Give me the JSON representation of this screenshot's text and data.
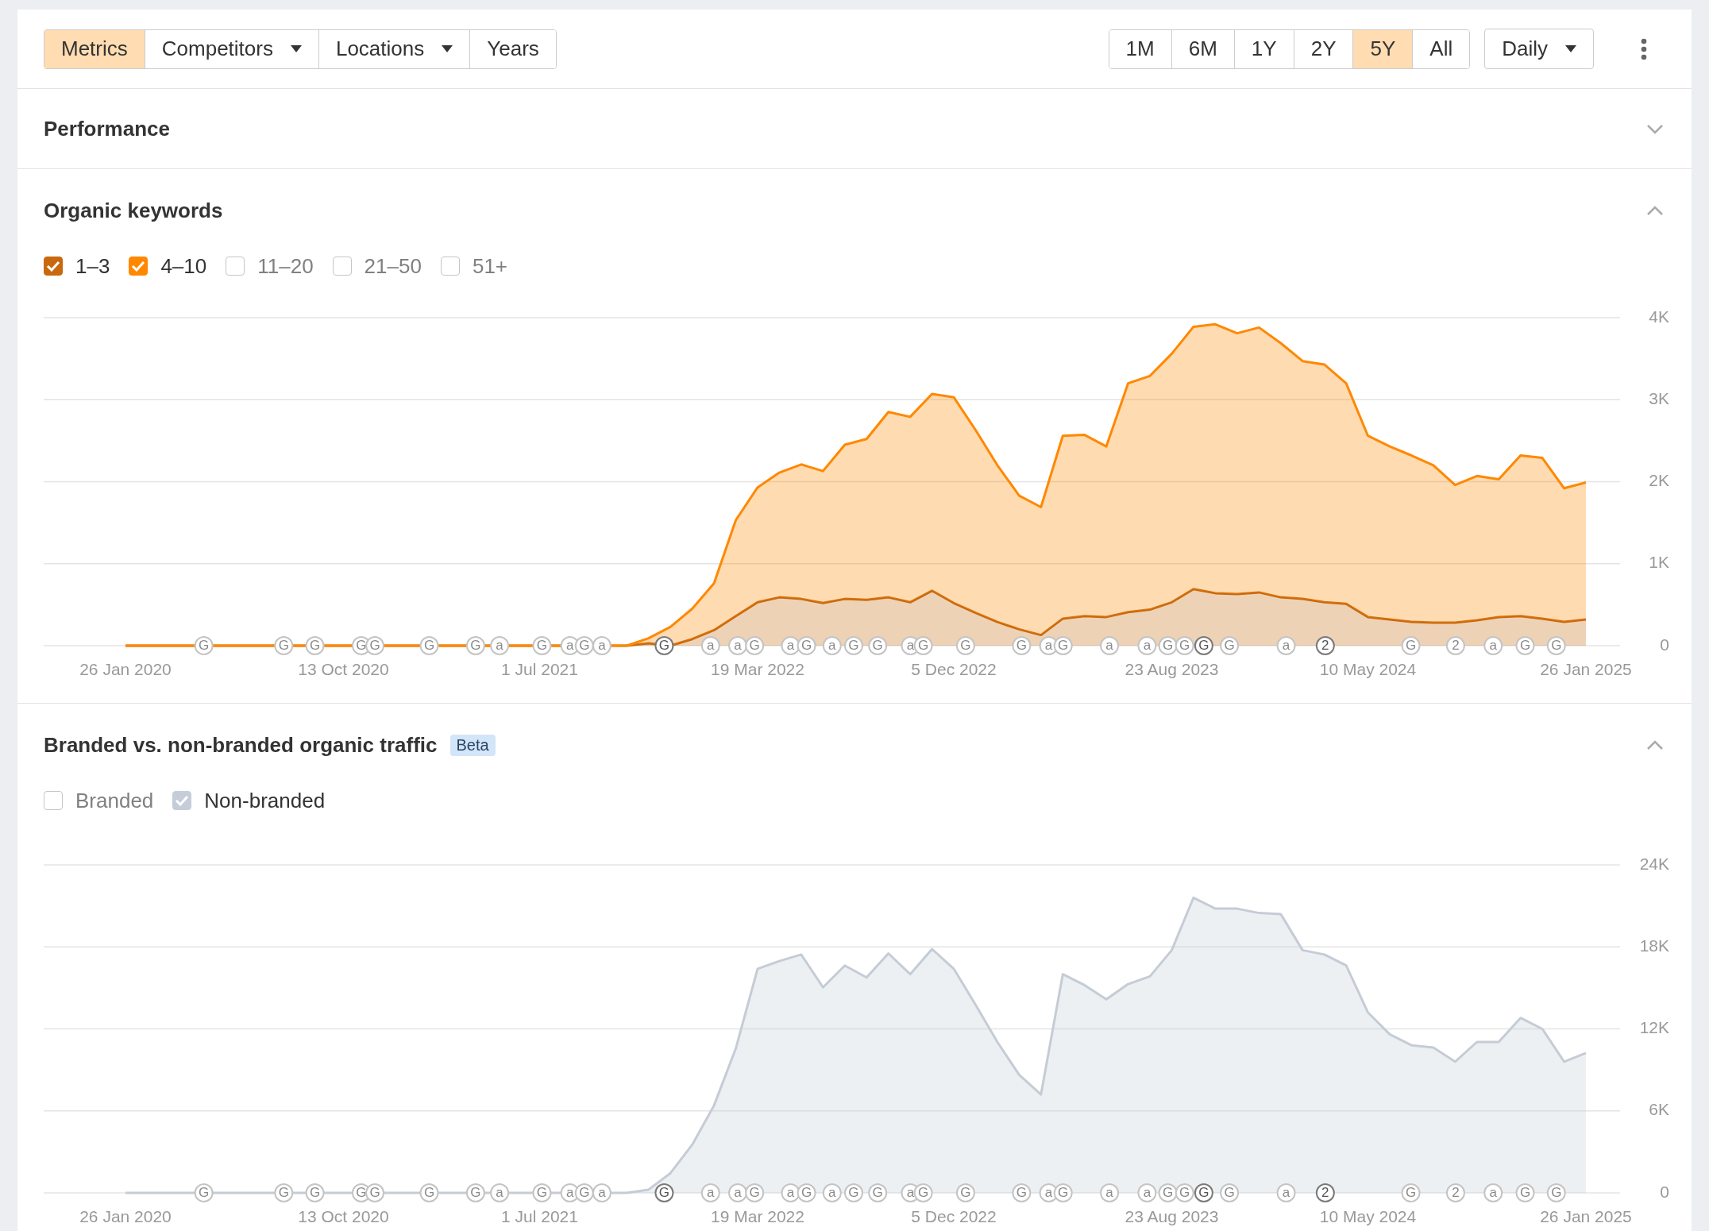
{
  "toolbar": {
    "tabs": [
      {
        "label": "Metrics",
        "selected": true,
        "dropdown": false
      },
      {
        "label": "Competitors",
        "selected": false,
        "dropdown": true
      },
      {
        "label": "Locations",
        "selected": false,
        "dropdown": true
      },
      {
        "label": "Years",
        "selected": false,
        "dropdown": false
      }
    ],
    "ranges": [
      {
        "label": "1M",
        "selected": false
      },
      {
        "label": "6M",
        "selected": false
      },
      {
        "label": "1Y",
        "selected": false
      },
      {
        "label": "2Y",
        "selected": false
      },
      {
        "label": "5Y",
        "selected": true
      },
      {
        "label": "All",
        "selected": false
      }
    ],
    "interval": {
      "label": "Daily"
    }
  },
  "sections": [
    {
      "title": "Performance",
      "expanded": false
    },
    {
      "title": "Organic keywords",
      "expanded": true,
      "filters": [
        {
          "label": "1–3",
          "checked": true,
          "color": "#c8690e"
        },
        {
          "label": "4–10",
          "checked": true,
          "color": "#ff8800"
        },
        {
          "label": "11–20",
          "checked": false
        },
        {
          "label": "21–50",
          "checked": false
        },
        {
          "label": "51+",
          "checked": false
        }
      ],
      "chart_data": {
        "type": "area",
        "stacked": true,
        "grid": true,
        "ylim": [
          0,
          4000
        ],
        "categories": [
          "26 Jan 2020",
          null,
          null,
          null,
          null,
          null,
          null,
          null,
          null,
          null,
          "13 Oct 2020",
          null,
          null,
          null,
          null,
          null,
          null,
          null,
          null,
          "1 Jul 2021",
          null,
          null,
          null,
          null,
          null,
          null,
          null,
          null,
          null,
          "19 Mar 2022",
          null,
          null,
          null,
          null,
          null,
          null,
          null,
          null,
          "5 Dec 2022",
          null,
          null,
          null,
          null,
          null,
          null,
          null,
          null,
          null,
          "23 Aug 2023",
          null,
          null,
          null,
          null,
          null,
          null,
          null,
          null,
          "10 May 2024",
          null,
          null,
          null,
          null,
          null,
          null,
          null,
          null,
          null,
          "26 Jan 2025"
        ],
        "series": [
          {
            "color": "#c8690e",
            "values": [
              0,
              0,
              0,
              0,
              0,
              0,
              0,
              0,
              0,
              0,
              0,
              0,
              0,
              0,
              0,
              0,
              0,
              0,
              0,
              0,
              0,
              0,
              0,
              0,
              30,
              null,
              80,
              190,
              360,
              530,
              590,
              570,
              520,
              570,
              560,
              590,
              530,
              670,
              520,
              400,
              290,
              200,
              130,
              330,
              360,
              350,
              410,
              440,
              530,
              690,
              640,
              630,
              650,
              590,
              570,
              530,
              510,
              350,
              320,
              290,
              280,
              280,
              310,
              350,
              360,
              330,
              290,
              320
            ]
          },
          {
            "color": "#ff8800",
            "values": [
              0,
              0,
              0,
              0,
              0,
              0,
              0,
              0,
              0,
              0,
              0,
              0,
              0,
              0,
              0,
              0,
              0,
              0,
              0,
              0,
              0,
              0,
              0,
              0,
              60,
              230,
              370,
              570,
              1170,
              1400,
              1520,
              1640,
              1610,
              1880,
              1960,
              2260,
              2260,
              2400,
              2510,
              2230,
              1910,
              1630,
              1560,
              2230,
              2210,
              2080,
              2790,
              2850,
              3030,
              3200,
              3280,
              3180,
              3230,
              3100,
              2900,
              2900,
              2690,
              2210,
              2110,
              2030,
              1920,
              1680,
              1760,
              1680,
              1960,
              1960,
              1630,
              1670
            ]
          }
        ],
        "yticks": [
          {
            "value": 0,
            "label": "0"
          },
          {
            "value": 1000,
            "label": "1K"
          },
          {
            "value": 2000,
            "label": "2K"
          },
          {
            "value": 3000,
            "label": "3K"
          },
          {
            "value": 4000,
            "label": "4K"
          }
        ]
      },
      "events": [
        {
          "label": "G",
          "highlighted": false
        },
        {
          "label": "G",
          "highlighted": false
        },
        {
          "label": "G",
          "highlighted": false
        },
        {
          "label": "G",
          "highlighted": false
        },
        {
          "label": "G",
          "highlighted": false
        },
        {
          "label": "G",
          "highlighted": false
        },
        {
          "label": "G",
          "highlighted": false
        },
        {
          "label": "a",
          "highlighted": false
        },
        {
          "label": "G",
          "highlighted": false
        },
        {
          "label": "a",
          "highlighted": false
        },
        {
          "label": "G",
          "highlighted": false
        },
        {
          "label": "a",
          "highlighted": false
        },
        {
          "label": "G",
          "highlighted": true
        },
        {
          "label": "a",
          "highlighted": false
        },
        {
          "label": "a",
          "highlighted": false
        },
        {
          "label": "G",
          "highlighted": false
        },
        {
          "label": "a",
          "highlighted": false
        },
        {
          "label": "G",
          "highlighted": false
        },
        {
          "label": "a",
          "highlighted": false
        },
        {
          "label": "G",
          "highlighted": false
        },
        {
          "label": "G",
          "highlighted": false
        },
        {
          "label": "a",
          "highlighted": false
        },
        {
          "label": "G",
          "highlighted": false
        },
        {
          "label": "G",
          "highlighted": false
        },
        {
          "label": "G",
          "highlighted": false
        },
        {
          "label": "a",
          "highlighted": false
        },
        {
          "label": "G",
          "highlighted": false
        },
        {
          "label": "a",
          "highlighted": false
        },
        {
          "label": "a",
          "highlighted": false
        },
        {
          "label": "G",
          "highlighted": false
        },
        {
          "label": "G",
          "highlighted": false
        },
        {
          "label": "G",
          "highlighted": true
        },
        {
          "label": "G",
          "highlighted": false
        },
        {
          "label": "a",
          "highlighted": false
        },
        {
          "label": "2",
          "highlighted": true
        },
        {
          "label": "G",
          "highlighted": false
        },
        {
          "label": "2",
          "highlighted": false
        },
        {
          "label": "a",
          "highlighted": false
        },
        {
          "label": "G",
          "highlighted": false
        },
        {
          "label": "G",
          "highlighted": false
        }
      ]
    },
    {
      "title": "Branded vs. non-branded organic traffic",
      "badge": "Beta",
      "expanded": true,
      "filters": [
        {
          "label": "Branded",
          "checked": false
        },
        {
          "label": "Non-branded",
          "checked": true,
          "color": "#c5cdd8"
        }
      ],
      "chart_data": {
        "type": "area",
        "stacked": false,
        "grid": true,
        "ylim": [
          0,
          24000
        ],
        "categories": [
          "26 Jan 2020",
          null,
          null,
          null,
          null,
          null,
          null,
          null,
          null,
          null,
          "13 Oct 2020",
          null,
          null,
          null,
          null,
          null,
          null,
          null,
          null,
          "1 Jul 2021",
          null,
          null,
          null,
          null,
          null,
          null,
          null,
          null,
          null,
          "19 Mar 2022",
          null,
          null,
          null,
          null,
          null,
          null,
          null,
          null,
          "5 Dec 2022",
          null,
          null,
          null,
          null,
          null,
          null,
          null,
          null,
          null,
          "23 Aug 2023",
          null,
          null,
          null,
          null,
          null,
          null,
          null,
          null,
          "10 May 2024",
          null,
          null,
          null,
          null,
          null,
          null,
          null,
          null,
          null,
          "26 Jan 2025"
        ],
        "series": [
          {
            "color": "#c5ccd6",
            "values": [
              0,
              0,
              0,
              0,
              0,
              0,
              0,
              0,
              0,
              0,
              0,
              0,
              0,
              0,
              0,
              0,
              0,
              0,
              0,
              0,
              0,
              0,
              0,
              0,
              240,
              1440,
              3520,
              6400,
              10560,
              16400,
              16960,
              17440,
              15040,
              16640,
              15760,
              17520,
              16000,
              17840,
              16400,
              13760,
              11040,
              8640,
              7200,
              16000,
              15200,
              14160,
              15280,
              15840,
              17760,
              21600,
              20800,
              20800,
              20480,
              20400,
              17760,
              17440,
              16640,
              13200,
              11600,
              10800,
              10640,
              9600,
              11040,
              11040,
              12800,
              12000,
              9600,
              10240
            ]
          }
        ],
        "yticks": [
          {
            "value": 0,
            "label": "0"
          },
          {
            "value": 6000,
            "label": "6K"
          },
          {
            "value": 12000,
            "label": "12K"
          },
          {
            "value": 18000,
            "label": "18K"
          },
          {
            "value": 24000,
            "label": "24K"
          }
        ]
      },
      "events": [
        {
          "label": "G",
          "highlighted": false
        },
        {
          "label": "G",
          "highlighted": false
        },
        {
          "label": "G",
          "highlighted": false
        },
        {
          "label": "G",
          "highlighted": false
        },
        {
          "label": "G",
          "highlighted": false
        },
        {
          "label": "G",
          "highlighted": false
        },
        {
          "label": "G",
          "highlighted": false
        },
        {
          "label": "a",
          "highlighted": false
        },
        {
          "label": "G",
          "highlighted": false
        },
        {
          "label": "a",
          "highlighted": false
        },
        {
          "label": "G",
          "highlighted": false
        },
        {
          "label": "a",
          "highlighted": false
        },
        {
          "label": "G",
          "highlighted": true
        },
        {
          "label": "a",
          "highlighted": false
        },
        {
          "label": "a",
          "highlighted": false
        },
        {
          "label": "G",
          "highlighted": false
        },
        {
          "label": "a",
          "highlighted": false
        },
        {
          "label": "G",
          "highlighted": false
        },
        {
          "label": "a",
          "highlighted": false
        },
        {
          "label": "G",
          "highlighted": false
        },
        {
          "label": "G",
          "highlighted": false
        },
        {
          "label": "a",
          "highlighted": false
        },
        {
          "label": "G",
          "highlighted": false
        },
        {
          "label": "G",
          "highlighted": false
        },
        {
          "label": "G",
          "highlighted": false
        },
        {
          "label": "a",
          "highlighted": false
        },
        {
          "label": "G",
          "highlighted": false
        },
        {
          "label": "a",
          "highlighted": false
        },
        {
          "label": "a",
          "highlighted": false
        },
        {
          "label": "G",
          "highlighted": false
        },
        {
          "label": "G",
          "highlighted": false
        },
        {
          "label": "G",
          "highlighted": true
        },
        {
          "label": "G",
          "highlighted": false
        },
        {
          "label": "a",
          "highlighted": false
        },
        {
          "label": "2",
          "highlighted": true
        },
        {
          "label": "G",
          "highlighted": false
        },
        {
          "label": "2",
          "highlighted": false
        },
        {
          "label": "a",
          "highlighted": false
        },
        {
          "label": "G",
          "highlighted": false
        },
        {
          "label": "G",
          "highlighted": false
        }
      ]
    }
  ]
}
